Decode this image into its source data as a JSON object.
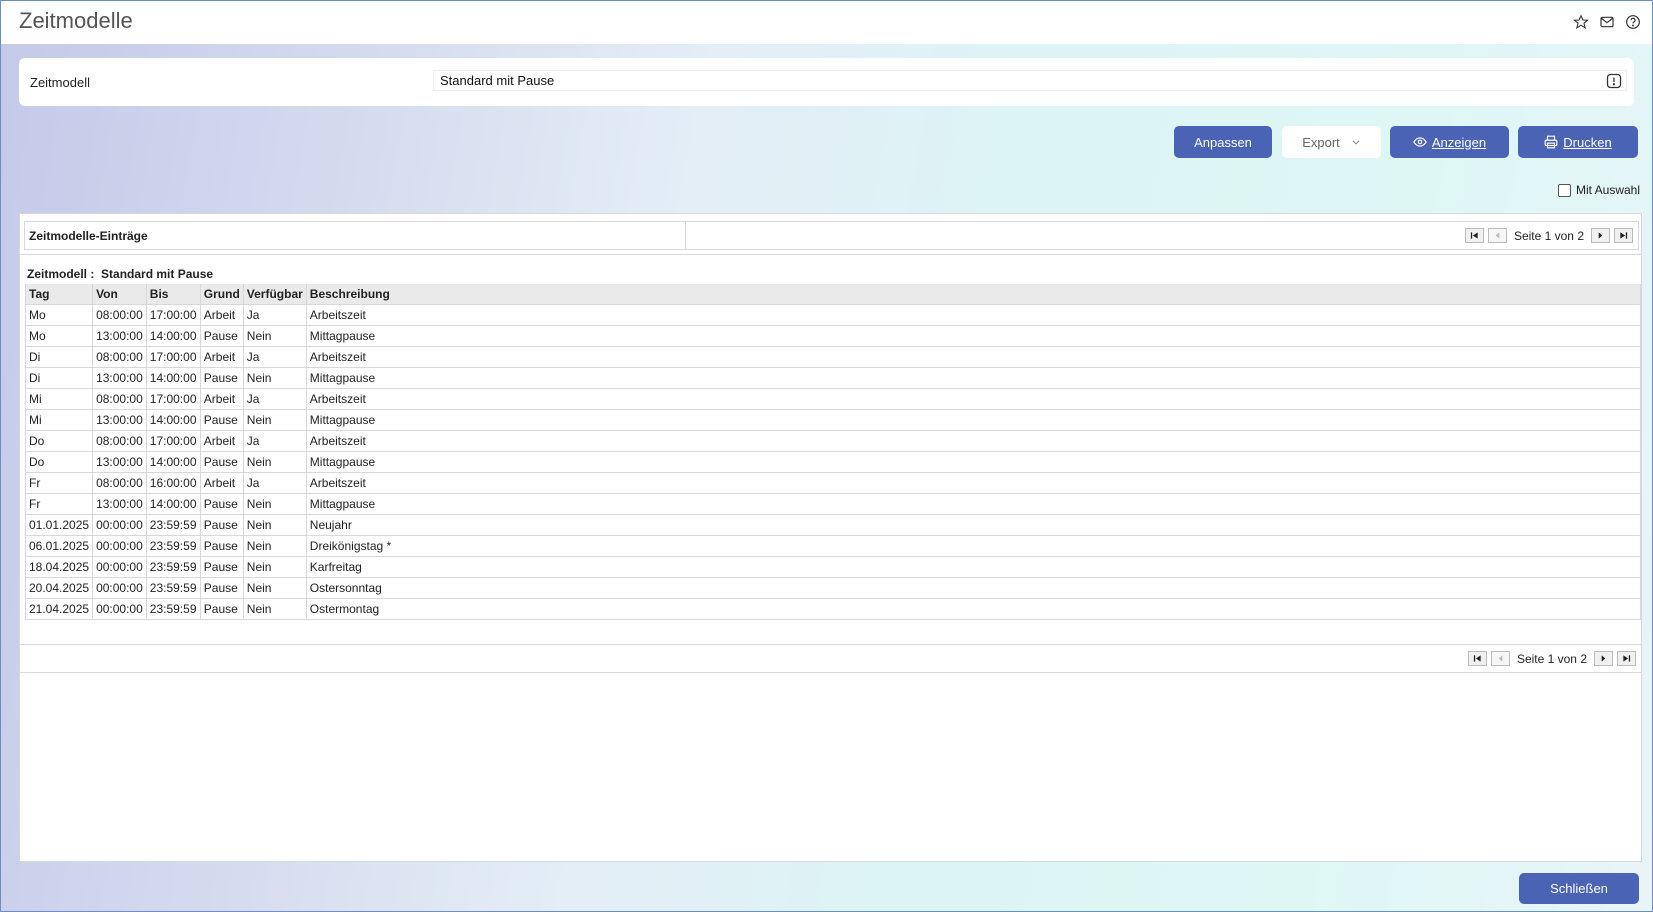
{
  "header": {
    "title": "Zeitmodelle",
    "icons": [
      "star-icon",
      "mail-icon",
      "help-icon"
    ]
  },
  "filter": {
    "label": "Zeitmodell",
    "value": "Standard mit Pause"
  },
  "toolbar": {
    "anpassen": "Anpassen",
    "export": "Export",
    "anzeigen": "Anzeigen",
    "drucken": "Drucken",
    "mit_auswahl": "Mit Auswahl"
  },
  "report": {
    "title": "Zeitmodelle-Einträge",
    "page_text": "Seite 1 von 2",
    "group_label": "Zeitmodell :",
    "group_value": "Standard mit Pause",
    "columns": [
      "Tag",
      "Von",
      "Bis",
      "Grund",
      "Verfügbar",
      "Beschreibung"
    ],
    "rows": [
      [
        "Mo",
        "08:00:00",
        "17:00:00",
        "Arbeit",
        "Ja",
        "Arbeitszeit"
      ],
      [
        "Mo",
        "13:00:00",
        "14:00:00",
        "Pause",
        "Nein",
        "Mittagpause"
      ],
      [
        "Di",
        "08:00:00",
        "17:00:00",
        "Arbeit",
        "Ja",
        "Arbeitszeit"
      ],
      [
        "Di",
        "13:00:00",
        "14:00:00",
        "Pause",
        "Nein",
        "Mittagpause"
      ],
      [
        "Mi",
        "08:00:00",
        "17:00:00",
        "Arbeit",
        "Ja",
        "Arbeitszeit"
      ],
      [
        "Mi",
        "13:00:00",
        "14:00:00",
        "Pause",
        "Nein",
        "Mittagpause"
      ],
      [
        "Do",
        "08:00:00",
        "17:00:00",
        "Arbeit",
        "Ja",
        "Arbeitszeit"
      ],
      [
        "Do",
        "13:00:00",
        "14:00:00",
        "Pause",
        "Nein",
        "Mittagpause"
      ],
      [
        "Fr",
        "08:00:00",
        "16:00:00",
        "Arbeit",
        "Ja",
        "Arbeitszeit"
      ],
      [
        "Fr",
        "13:00:00",
        "14:00:00",
        "Pause",
        "Nein",
        "Mittagpause"
      ],
      [
        "01.01.2025",
        "00:00:00",
        "23:59:59",
        "Pause",
        "Nein",
        "Neujahr"
      ],
      [
        "06.01.2025",
        "00:00:00",
        "23:59:59",
        "Pause",
        "Nein",
        "Dreikönigstag *"
      ],
      [
        "18.04.2025",
        "00:00:00",
        "23:59:59",
        "Pause",
        "Nein",
        "Karfreitag"
      ],
      [
        "20.04.2025",
        "00:00:00",
        "23:59:59",
        "Pause",
        "Nein",
        "Ostersonntag"
      ],
      [
        "21.04.2025",
        "00:00:00",
        "23:59:59",
        "Pause",
        "Nein",
        "Ostermontag"
      ]
    ]
  },
  "footer": {
    "close": "Schließen"
  },
  "colors": {
    "primary": "#4a63b4"
  }
}
